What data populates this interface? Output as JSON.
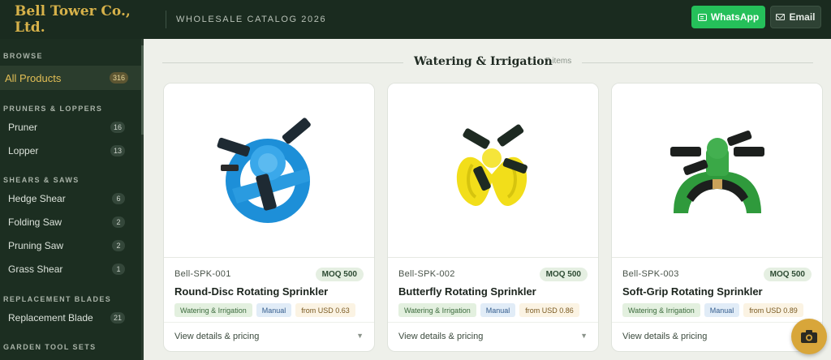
{
  "header": {
    "brand": "Bell Tower Co., Ltd.",
    "catalog": "WHOLESALE CATALOG 2026",
    "whatsapp_label": "WhatsApp",
    "email_label": "Email"
  },
  "sidebar": {
    "browse_label": "BROWSE",
    "all_products": {
      "label": "All Products",
      "count": "316"
    },
    "sections": [
      {
        "title": "PRUNERS & LOPPERS",
        "items": [
          {
            "label": "Pruner",
            "count": "16"
          },
          {
            "label": "Lopper",
            "count": "13"
          }
        ]
      },
      {
        "title": "SHEARS & SAWS",
        "items": [
          {
            "label": "Hedge Shear",
            "count": "6"
          },
          {
            "label": "Folding Saw",
            "count": "2"
          },
          {
            "label": "Pruning Saw",
            "count": "2"
          },
          {
            "label": "Grass Shear",
            "count": "1"
          }
        ]
      },
      {
        "title": "REPLACEMENT BLADES",
        "items": [
          {
            "label": "Replacement Blade",
            "count": "21"
          }
        ]
      },
      {
        "title": "GARDEN TOOL SETS",
        "items": []
      }
    ]
  },
  "main": {
    "section_title": "Watering & Irrigation",
    "section_count": "7 items",
    "products": [
      {
        "sku": "Bell-SPK-001",
        "moq": "MOQ 500",
        "name": "Round-Disc Rotating Sprinkler",
        "category": "Watering & Irrigation",
        "type": "Manual",
        "price": "from USD 0.63",
        "link": "View details & pricing",
        "color": "#2a9be0",
        "dark": "#1672ad"
      },
      {
        "sku": "Bell-SPK-002",
        "moq": "MOQ 500",
        "name": "Butterfly Rotating Sprinkler",
        "category": "Watering & Irrigation",
        "type": "Manual",
        "price": "from USD 0.86",
        "link": "View details & pricing",
        "color": "#f2de1a",
        "dark": "#c2ae0c"
      },
      {
        "sku": "Bell-SPK-003",
        "moq": "MOQ 500",
        "name": "Soft-Grip Rotating Sprinkler",
        "category": "Watering & Irrigation",
        "type": "Manual",
        "price": "from USD 0.89",
        "link": "View details & pricing",
        "color": "#2f9a3c",
        "dark": "#1e6f29"
      }
    ]
  },
  "icons": {
    "whatsapp": "chat-icon",
    "email": "mail-icon",
    "fab": "camera-icon",
    "caret": "caret-down-icon"
  }
}
